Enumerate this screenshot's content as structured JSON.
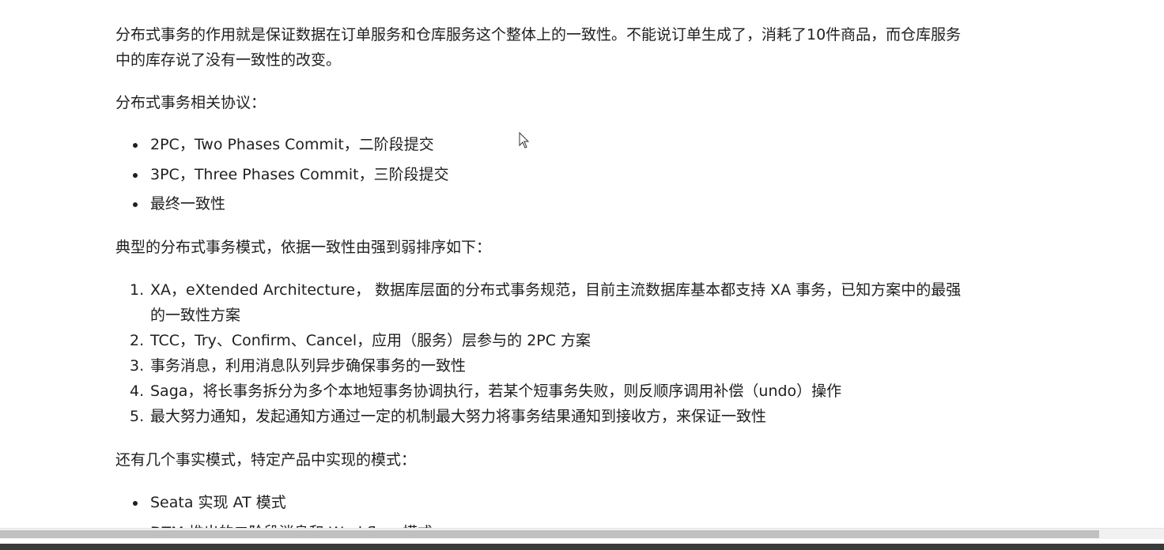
{
  "paragraphs": {
    "intro": "分布式事务的作用就是保证数据在订单服务和仓库服务这个整体上的一致性。不能说订单生成了，消耗了10件商品，而仓库服务中的库存说了没有一致性的改变。",
    "protocols_heading": "分布式事务相关协议：",
    "modes_heading": "典型的分布式事务模式，依据一致性由强到弱排序如下：",
    "fact_modes_heading": "还有几个事实模式，特定产品中实现的模式："
  },
  "protocols": [
    "2PC，Two Phases Commit，二阶段提交",
    "3PC，Three Phases Commit，三阶段提交",
    "最终一致性"
  ],
  "modes": [
    {
      "num": "1.",
      "text": "XA，eXtended Architecture， 数据库层面的分布式事务规范，目前主流数据库基本都支持 XA 事务，已知方案中的最强的一致性方案"
    },
    {
      "num": "2.",
      "text": "TCC，Try、Confirm、Cancel，应用（服务）层参与的 2PC 方案"
    },
    {
      "num": "3.",
      "text": "事务消息，利用消息队列异步确保事务的一致性"
    },
    {
      "num": "4.",
      "text": "Saga，将长事务拆分为多个本地短事务协调执行，若某个短事务失败，则反顺序调用补偿（undo）操作"
    },
    {
      "num": "5.",
      "text": "最大努力通知，发起通知方通过一定的机制最大努力将事务结果通知到接收方，来保证一致性"
    }
  ],
  "fact_modes": [
    "Seata 实现 AT 模式",
    "DTM 推出的二阶段消息和 Workflow 模式"
  ]
}
